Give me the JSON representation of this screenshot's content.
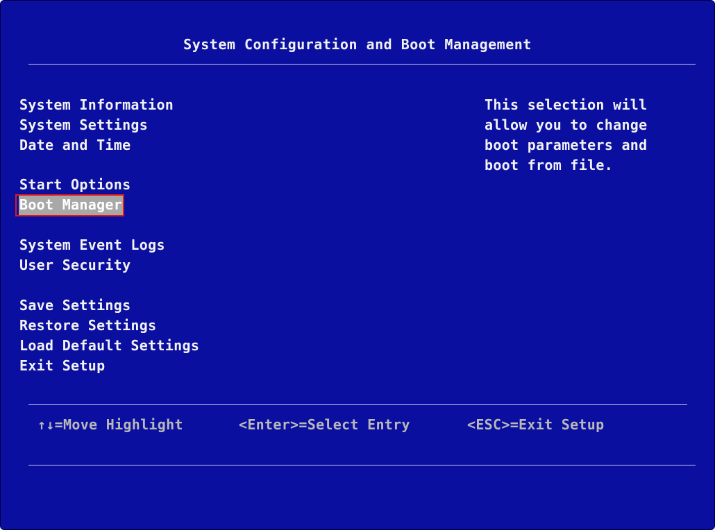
{
  "header": {
    "title": "System Configuration and Boot Management"
  },
  "menu": {
    "items": [
      {
        "label": "System Information"
      },
      {
        "label": "System Settings"
      },
      {
        "label": "Date and Time"
      },
      {
        "label": "Start Options"
      },
      {
        "label": "Boot Manager",
        "selected": true
      },
      {
        "label": "System Event Logs"
      },
      {
        "label": "User Security"
      },
      {
        "label": "Save Settings"
      },
      {
        "label": "Restore Settings"
      },
      {
        "label": "Load Default Settings"
      },
      {
        "label": "Exit Setup"
      }
    ]
  },
  "help": {
    "lines": [
      "This selection will",
      "allow you to change",
      "boot parameters and",
      "boot from file."
    ]
  },
  "footer": {
    "move": "↑↓=Move Highlight",
    "select": "<Enter>=Select Entry",
    "exit": "<ESC>=Exit Setup"
  },
  "colors": {
    "background": "#0a0fa0",
    "highlight": "#a8a8a8",
    "selection_outline": "#e01818"
  }
}
